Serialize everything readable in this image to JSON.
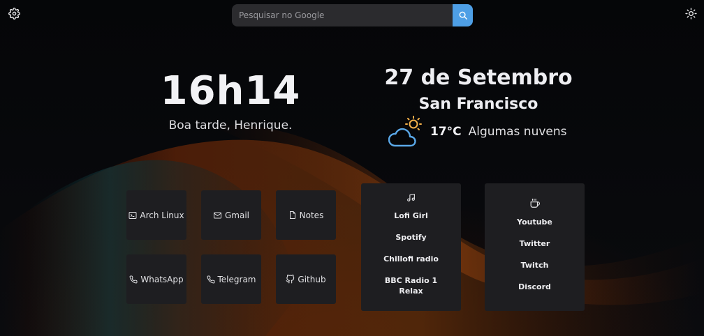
{
  "search": {
    "placeholder": "Pesquisar no Google"
  },
  "clock": {
    "time": "16h14",
    "greeting": "Boa tarde, Henrique."
  },
  "date": {
    "label": "27 de Setembro",
    "city": "San Francisco"
  },
  "weather": {
    "temp": "17°C",
    "description": "Algumas nuvens",
    "icon": "partly-cloudy-icon"
  },
  "shortcuts": [
    {
      "label": "Arch Linux",
      "icon": "terminal-icon"
    },
    {
      "label": "Gmail",
      "icon": "mail-icon"
    },
    {
      "label": "Notes",
      "icon": "file-icon"
    },
    {
      "label": "WhatsApp",
      "icon": "phone-icon"
    },
    {
      "label": "Telegram",
      "icon": "phone-icon"
    },
    {
      "label": "Github",
      "icon": "github-icon"
    }
  ],
  "music": {
    "icon": "music-note-icon",
    "links": [
      "Lofi Girl",
      "Spotify",
      "Chillofi radio",
      "BBC Radio 1 Relax"
    ]
  },
  "social": {
    "icon": "coffee-cup-icon",
    "links": [
      "Youtube",
      "Twitter",
      "Twitch",
      "Discord"
    ]
  },
  "colors": {
    "accent": "#4e9fe6",
    "tile": "#1e1e21",
    "search": "#2b2b2e",
    "sun": "#f2b04a",
    "cloud": "#5aa8e8"
  }
}
